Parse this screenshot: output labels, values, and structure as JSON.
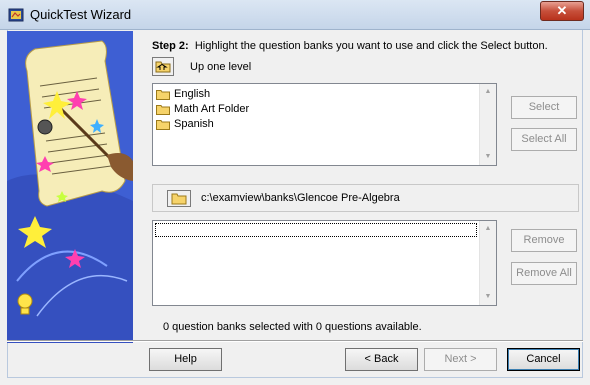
{
  "window": {
    "title": "QuickTest Wizard",
    "close_glyph": "✕"
  },
  "instructions": {
    "step_label": "Step 2:",
    "text": "Highlight the question banks you want to use and click the Select button."
  },
  "up_one_level": {
    "label": "Up one level",
    "icon": "folder-up-icon"
  },
  "available_banks": {
    "items": [
      {
        "label": "English",
        "icon": "folder-icon"
      },
      {
        "label": "Math Art Folder",
        "icon": "folder-icon"
      },
      {
        "label": "Spanish",
        "icon": "folder-icon"
      }
    ]
  },
  "side_buttons": {
    "select": "Select",
    "select_all": "Select All",
    "remove": "Remove",
    "remove_all": "Remove All"
  },
  "current_path": {
    "value": "c:\\examview\\banks\\Glencoe Pre-Algebra",
    "icon": "folder-icon"
  },
  "selected_banks": {
    "items": []
  },
  "status": "0 question banks selected with 0 questions available.",
  "footer": {
    "help": "Help",
    "back": "< Back",
    "next": "Next >",
    "cancel": "Cancel"
  },
  "colors": {
    "art_background": "#3e5fd3",
    "close_button": "#c7503b",
    "disabled_text": "#8d8d8d"
  }
}
